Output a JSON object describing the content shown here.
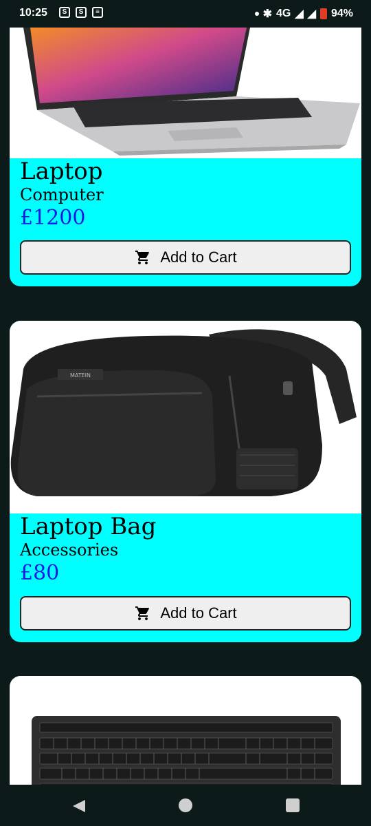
{
  "status_bar": {
    "time": "10:25",
    "network": "4G",
    "battery": "94%"
  },
  "products": [
    {
      "name": "Laptop",
      "category": "Computer",
      "price": "£1200",
      "button_label": "Add to Cart",
      "image_icon": "laptop-image"
    },
    {
      "name": "Laptop Bag",
      "category": "Accessories",
      "price": "£80",
      "button_label": "Add to Cart",
      "image_icon": "backpack-image"
    },
    {
      "image_icon": "keyboard-image"
    }
  ],
  "colors": {
    "card_background": "#00ffff",
    "price_text": "#1a1ae6",
    "page_background": "#0d1a1a"
  }
}
